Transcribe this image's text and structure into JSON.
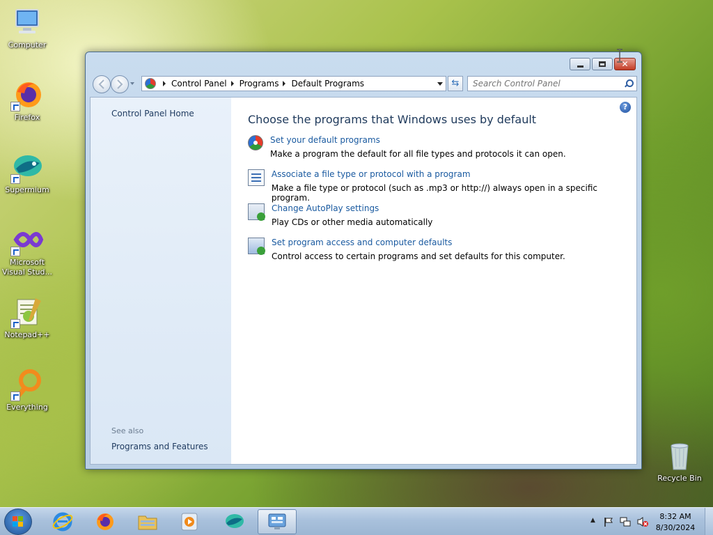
{
  "desktop": {
    "icons": [
      {
        "label": "Computer"
      },
      {
        "label": "Firefox"
      },
      {
        "label": "Supermium"
      },
      {
        "label": "Microsoft Visual Stud..."
      },
      {
        "label": "Notepad++"
      },
      {
        "label": "Everything"
      },
      {
        "label": "Recycle Bin"
      }
    ]
  },
  "window": {
    "breadcrumb": [
      "Control Panel",
      "Programs",
      "Default Programs"
    ],
    "search_placeholder": "Search Control Panel",
    "left_pane": {
      "home_link": "Control Panel Home",
      "see_also": "See also",
      "programs_and_features": "Programs and Features"
    },
    "main": {
      "title": "Choose the programs that Windows uses by default",
      "tasks": [
        {
          "link": "Set your default programs",
          "desc": "Make a program the default for all file types and protocols it can open.",
          "icon": "default-programs-icon"
        },
        {
          "link": "Associate a file type or protocol with a program",
          "desc": "Make a file type or protocol (such as .mp3 or http://) always open in a specific program.",
          "icon": "file-association-icon"
        },
        {
          "link": "Change AutoPlay settings",
          "desc": "Play CDs or other media automatically",
          "icon": "autoplay-icon"
        },
        {
          "link": "Set program access and computer defaults",
          "desc": "Control access to certain programs and set defaults for this computer.",
          "icon": "program-access-icon"
        }
      ]
    }
  },
  "taskbar": {
    "time": "8:32 AM",
    "date": "8/30/2024"
  },
  "colors": {
    "link": "#1a5aa0",
    "title": "#1e395b",
    "close_button": "#c33c25"
  }
}
